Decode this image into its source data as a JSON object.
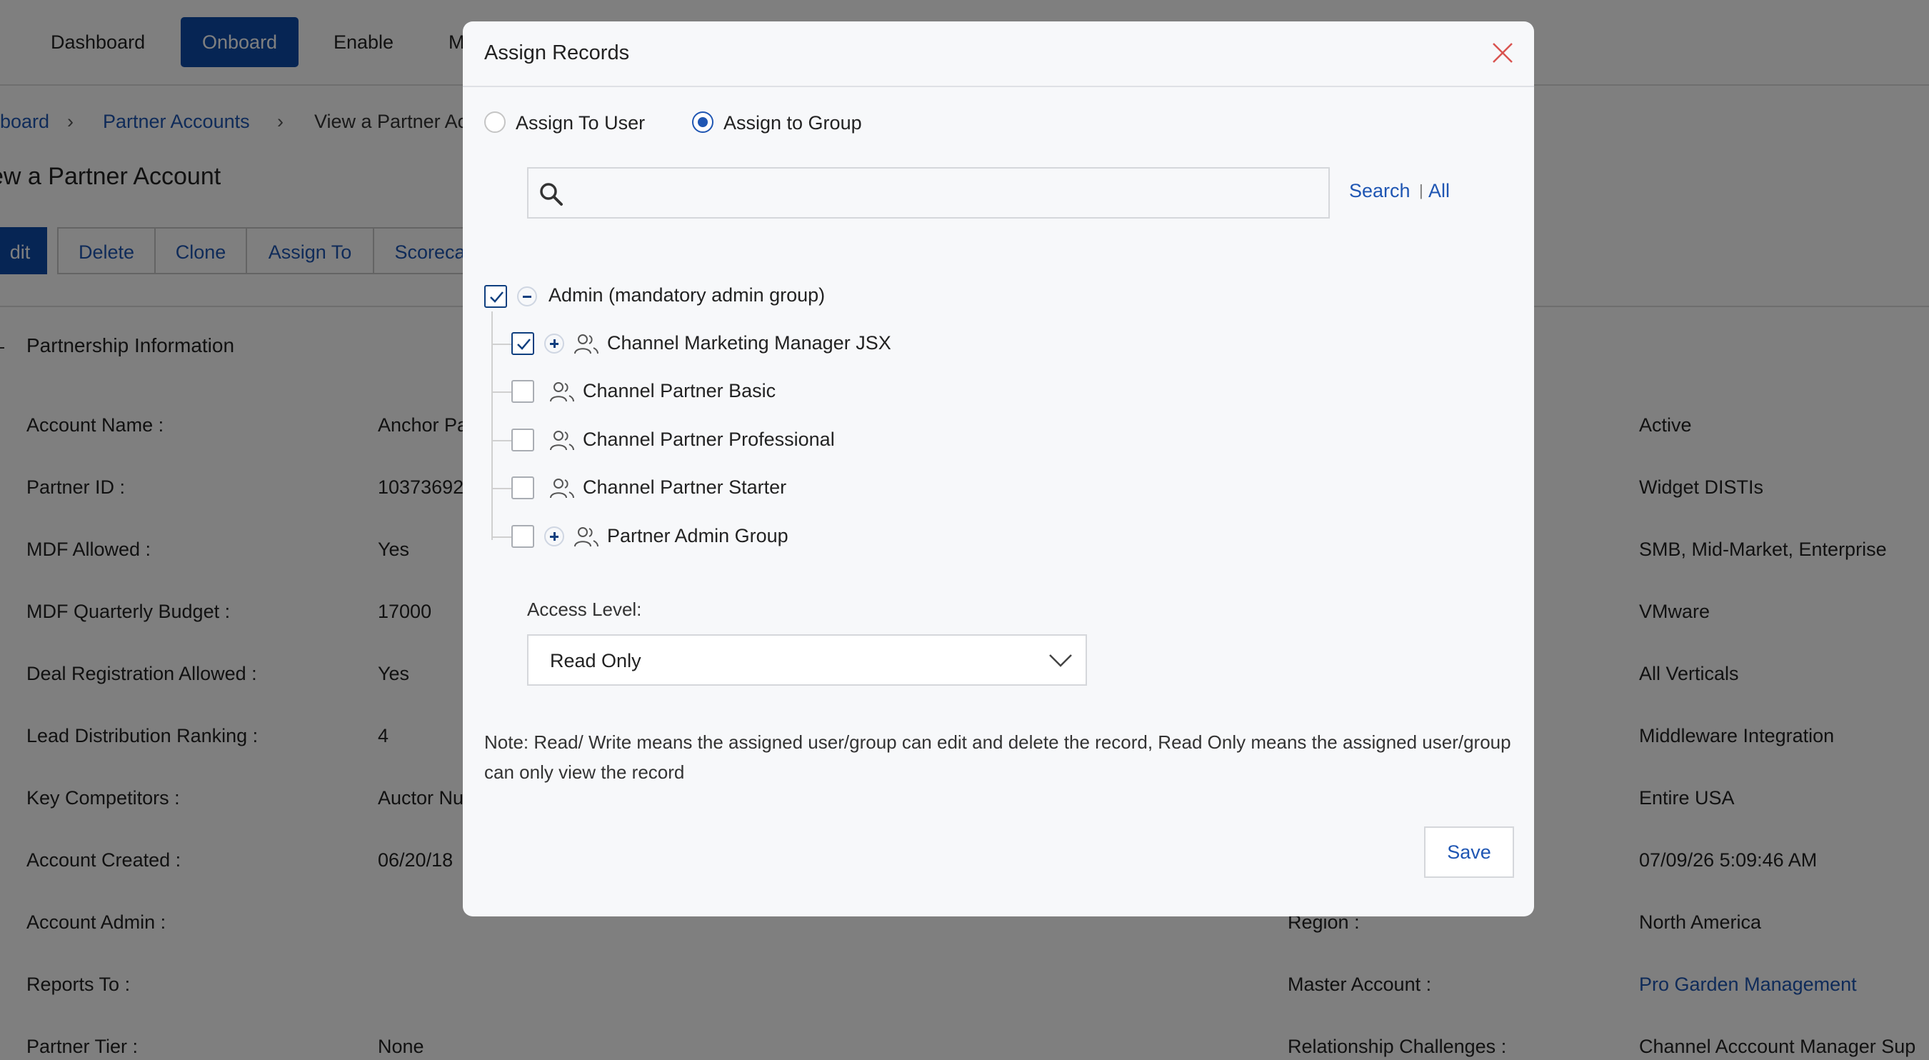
{
  "nav": {
    "items": [
      "Dashboard",
      "Onboard",
      "Enable",
      "M"
    ]
  },
  "breadcrumb": {
    "first": "board",
    "second": "Partner Accounts",
    "third": "View a Partner Ac",
    "separator": "›"
  },
  "page_title": "ew a Partner Account",
  "actions": [
    "dit",
    "Delete",
    "Clone",
    "Assign To",
    "Scoreca"
  ],
  "section": {
    "title": "Partnership Information"
  },
  "fields_left": [
    {
      "label": "Account Name :",
      "value": "Anchor Pa"
    },
    {
      "label": "Partner ID :",
      "value": "10373692"
    },
    {
      "label": "MDF Allowed :",
      "value": "Yes"
    },
    {
      "label": "MDF Quarterly Budget :",
      "value": "17000"
    },
    {
      "label": "Deal Registration Allowed :",
      "value": "Yes"
    },
    {
      "label": "Lead Distribution Ranking :",
      "value": "4"
    },
    {
      "label": "Key Competitors :",
      "value": "Auctor Nu"
    },
    {
      "label": "Account Created :",
      "value": "06/20/18"
    },
    {
      "label": "Account Admin :",
      "value": ""
    },
    {
      "label": "Reports To :",
      "value": ""
    },
    {
      "label": "Partner Tier :",
      "value": "None"
    }
  ],
  "fields_right": [
    {
      "label": "",
      "value": "Active"
    },
    {
      "label": "",
      "value": "Widget DISTIs"
    },
    {
      "label": "",
      "value": "SMB, Mid-Market, Enterprise"
    },
    {
      "label": "",
      "value": "VMware"
    },
    {
      "label": "",
      "value": "All Verticals"
    },
    {
      "label": "",
      "value": "Middleware Integration"
    },
    {
      "label": "",
      "value": "Entire USA"
    },
    {
      "label": "",
      "value": "07/09/26 5:09:46 AM"
    },
    {
      "label": "Region :",
      "value": "North America"
    },
    {
      "label": "Master Account :",
      "value": "Pro Garden Management"
    },
    {
      "label": "Relationship Challenges :",
      "value": "Channel Acccount Manager Sup"
    }
  ],
  "modal": {
    "title": "Assign Records",
    "radio_user": "Assign To User",
    "radio_group": "Assign to Group",
    "selected": "group",
    "search": {
      "placeholder": "",
      "value": "",
      "search_link": "Search",
      "sep": "|",
      "all_link": "All"
    },
    "tree": {
      "root": {
        "label": "Admin (mandatory admin group)",
        "checked": true
      },
      "children": [
        {
          "label": "Channel Marketing Manager JSX",
          "checked": true,
          "expandable": true
        },
        {
          "label": "Channel Partner Basic",
          "checked": false,
          "expandable": false
        },
        {
          "label": "Channel Partner Professional",
          "checked": false,
          "expandable": false
        },
        {
          "label": "Channel Partner Starter",
          "checked": false,
          "expandable": false
        },
        {
          "label": "Partner Admin Group",
          "checked": false,
          "expandable": true
        }
      ]
    },
    "access_level_label": "Access Level:",
    "access_level_value": "Read Only",
    "note": "Note: Read/ Write means the assigned user/group can edit and delete the record, Read Only means the assigned user/group can only view the record",
    "save_label": "Save"
  },
  "colors": {
    "accent": "#1f56b3",
    "nav_active": "#0d4aa8",
    "close": "#d9534f"
  }
}
